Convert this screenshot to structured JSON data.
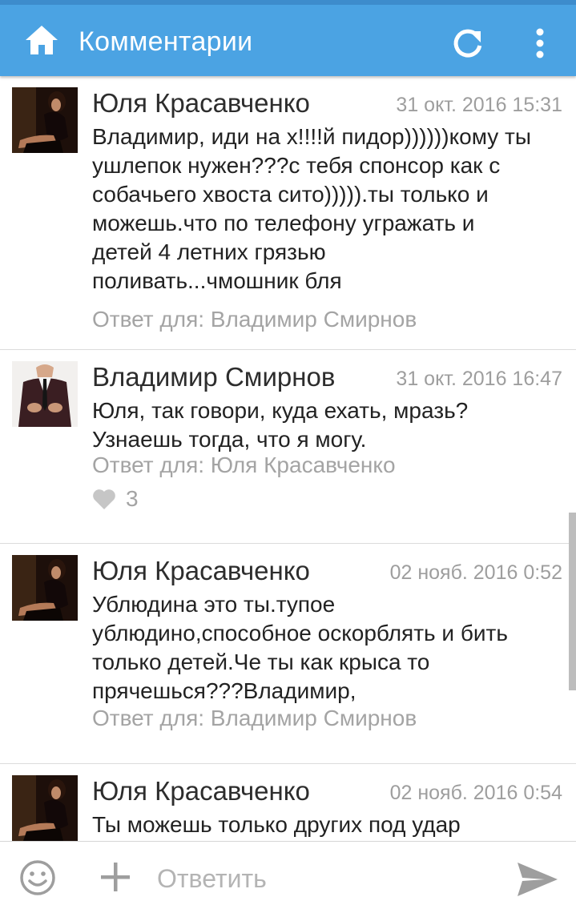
{
  "header": {
    "title": "Комментарии",
    "icons": {
      "home": "home-icon",
      "refresh": "refresh-icon",
      "menu": "more-vert-icon"
    },
    "background_color": "#4ba3e3"
  },
  "comments": [
    {
      "author": "Юля Красавченко",
      "date": "31 окт. 2016 15:31",
      "lines": [
        "Владимир, иди на х!!!!й пидор))))))кому ты",
        "ушлепок нужен???с тебя спонсор как с",
        "собачьего хвоста сито))))).ты только и",
        "можешь.что по телефону угражать и",
        "детей 4 летних грязью",
        "поливать...чмошник бля"
      ],
      "reply_to": "Ответ для: Владимир Смирнов"
    },
    {
      "author": "Владимир Смирнов",
      "date": "31 окт. 2016 16:47",
      "lines": [
        "Юля, так говори, куда ехать, мразь?",
        "Узнаешь тогда, что я могу."
      ],
      "reply_to": "Ответ для: Юля Красавченко",
      "likes": "3"
    },
    {
      "author": "Юля Красавченко",
      "date": "02 нояб. 2016 0:52",
      "lines": [
        "Ублюдина это ты.тупое",
        "ублюдино,способное оскорблять и бить",
        "только детей.Че ты как крыса то",
        "прячешься???Владимир,"
      ],
      "reply_to": "Ответ для: Владимир Смирнов"
    },
    {
      "author": "Юля Красавченко",
      "date": "02 нояб. 2016 0:54",
      "lines": [
        "Ты можешь только других под удар"
      ]
    }
  ],
  "composer": {
    "placeholder": "Ответить",
    "icons": {
      "emoji": "emoji-icon",
      "attach": "plus-icon",
      "send": "send-icon"
    }
  }
}
